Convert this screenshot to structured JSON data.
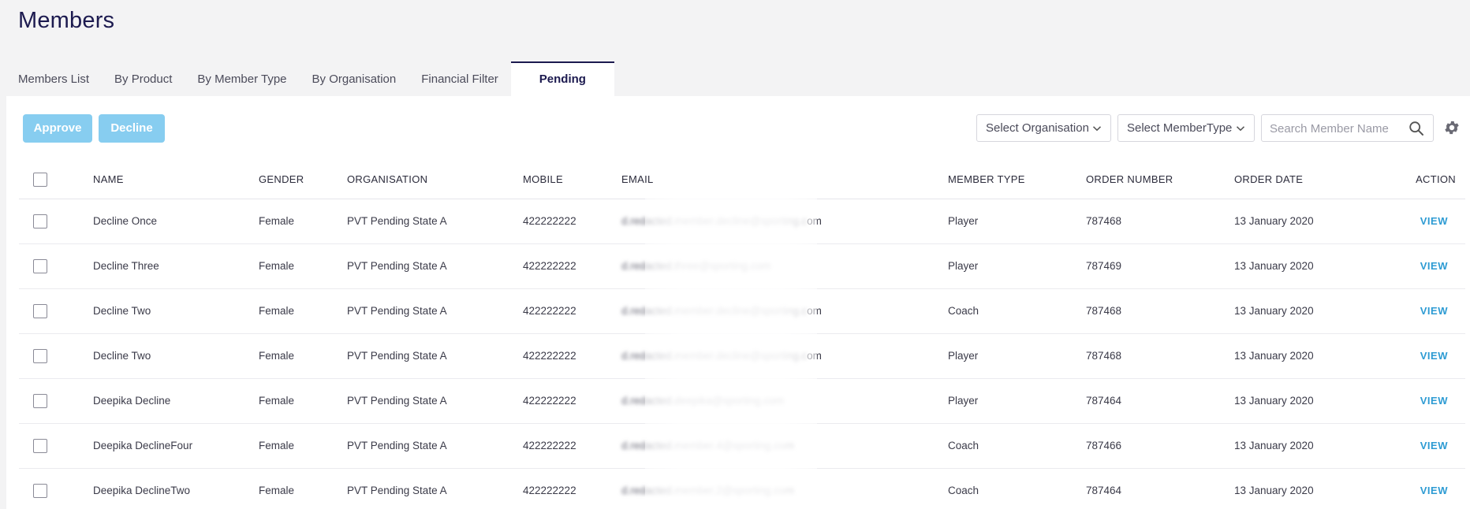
{
  "page": {
    "title": "Members"
  },
  "tabs": [
    {
      "label": "Members List"
    },
    {
      "label": "By Product"
    },
    {
      "label": "By Member Type"
    },
    {
      "label": "By Organisation"
    },
    {
      "label": "Financial Filter"
    },
    {
      "label": "Pending",
      "active": true
    }
  ],
  "toolbar": {
    "approve_label": "Approve",
    "decline_label": "Decline",
    "org_select": "Select Organisation",
    "type_select": "Select MemberType",
    "search_placeholder": "Search Member Name",
    "icons": {
      "search": "search-icon",
      "settings": "gear-icon",
      "dropdown": "chevron-down-icon"
    }
  },
  "colors": {
    "accent": "#1c1a4f",
    "button": "#87cdf0",
    "link": "#2d9bd3"
  },
  "table": {
    "columns": [
      "NAME",
      "GENDER",
      "ORGANISATION",
      "MOBILE",
      "EMAIL",
      "MEMBER TYPE",
      "ORDER NUMBER",
      "ORDER DATE",
      "ACTION"
    ],
    "rows": [
      {
        "name": "Decline Once",
        "gender": "Female",
        "organisation": "PVT Pending State A",
        "mobile": "422222222",
        "email": "d.redacted.member.decline@sporting.c",
        "email_suffix": "om",
        "type": "Player",
        "order": "787468",
        "date": "13 January 2020",
        "action": "VIEW"
      },
      {
        "name": "Decline Three",
        "gender": "Female",
        "organisation": "PVT Pending State A",
        "mobile": "422222222",
        "email": "d.redacted.three@sporting.com",
        "email_suffix": "",
        "type": "Player",
        "order": "787469",
        "date": "13 January 2020",
        "action": "VIEW"
      },
      {
        "name": "Decline Two",
        "gender": "Female",
        "organisation": "PVT Pending State A",
        "mobile": "422222222",
        "email": "d.redacted.member.decline@sporting.c",
        "email_suffix": "om",
        "type": "Coach",
        "order": "787468",
        "date": "13 January 2020",
        "action": "VIEW"
      },
      {
        "name": "Decline Two",
        "gender": "Female",
        "organisation": "PVT Pending State A",
        "mobile": "422222222",
        "email": "d.redacted.member.decline@sporting.c",
        "email_suffix": "om",
        "type": "Player",
        "order": "787468",
        "date": "13 January 2020",
        "action": "VIEW"
      },
      {
        "name": "Deepika Decline",
        "gender": "Female",
        "organisation": "PVT Pending State A",
        "mobile": "422222222",
        "email": "d.redacted.deepika@sporting.com",
        "email_suffix": "",
        "type": "Player",
        "order": "787464",
        "date": "13 January 2020",
        "action": "VIEW"
      },
      {
        "name": "Deepika DeclineFour",
        "gender": "Female",
        "organisation": "PVT Pending State A",
        "mobile": "422222222",
        "email": "d.redacted.member.4@sporting.com",
        "email_suffix": "",
        "type": "Coach",
        "order": "787466",
        "date": "13 January 2020",
        "action": "VIEW"
      },
      {
        "name": "Deepika DeclineTwo",
        "gender": "Female",
        "organisation": "PVT Pending State A",
        "mobile": "422222222",
        "email": "d.redacted.member.2@sporting.com",
        "email_suffix": "",
        "type": "Coach",
        "order": "787464",
        "date": "13 January 2020",
        "action": "VIEW"
      }
    ]
  }
}
